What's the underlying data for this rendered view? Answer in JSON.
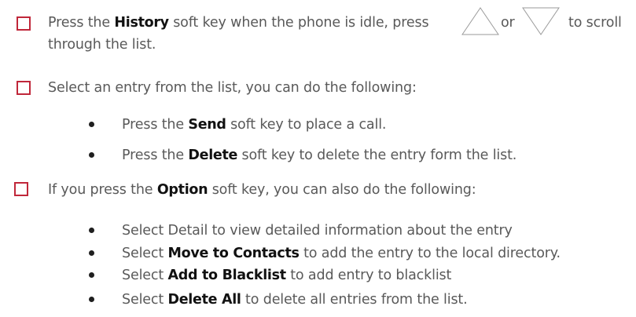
{
  "steps": [
    {
      "line1": {
        "pre": "Press the ",
        "bold": "History",
        "mid": " soft key when the phone is idle, press",
        "or": "or",
        "post": "to scroll"
      },
      "line2": "through the list."
    },
    {
      "text": "Select an entry from the list, you can do the following:"
    },
    {
      "pre": "If you press the ",
      "bold": "Option",
      "post": " soft key, you can also do the following:"
    }
  ],
  "list1": [
    {
      "pre": "Press the ",
      "bold": "Send",
      "post": " soft key to place a call."
    },
    {
      "pre": "Press the ",
      "bold": "Delete",
      "post": " soft key to delete the entry form the list."
    }
  ],
  "list2": [
    {
      "pre": "Select Detail to view detailed information about the entry",
      "bold": "",
      "post": ""
    },
    {
      "pre": "Select ",
      "bold": "Move to Contacts",
      "post": " to add the entry to the local directory."
    },
    {
      "pre": "Select ",
      "bold": "Add to Blacklist",
      "post": " to add entry to blacklist"
    },
    {
      "pre": "Select ",
      "bold": "Delete All",
      "post": " to delete all entries from the list."
    }
  ],
  "icons": {
    "up": "triangle-up-icon",
    "down": "triangle-down-icon"
  },
  "colors": {
    "checkbox": "#c0273a",
    "text": "#595959",
    "bold": "#111111"
  }
}
